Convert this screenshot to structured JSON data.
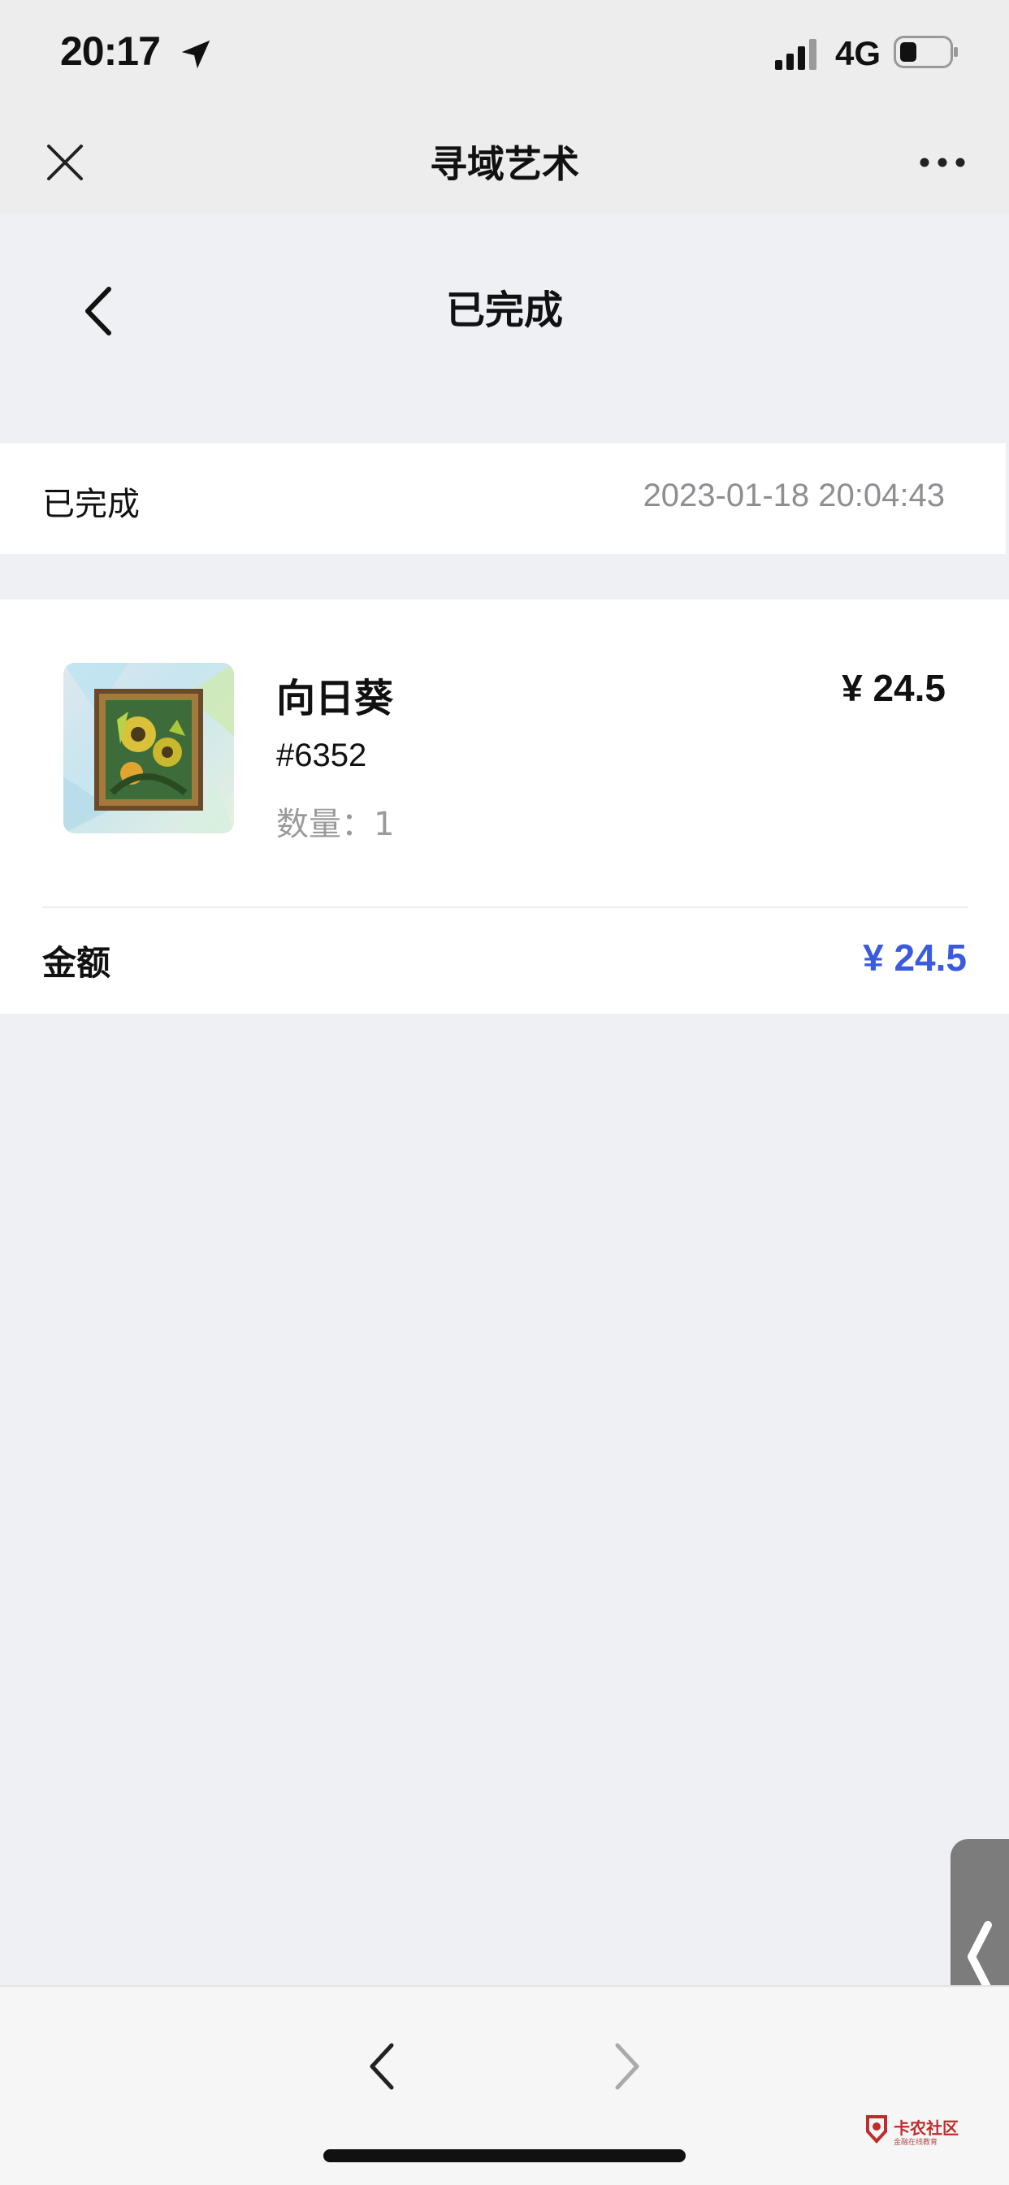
{
  "status_bar": {
    "time": "20:17",
    "network": "4G"
  },
  "nav": {
    "title": "寻域艺术"
  },
  "page": {
    "title": "已完成"
  },
  "order_status": {
    "label": "已完成",
    "datetime": "2023-01-18 20:04:43"
  },
  "item": {
    "name": "向日葵",
    "price": "¥ 24.5",
    "id": "#6352",
    "quantity": "数量：1"
  },
  "amount": {
    "label": "金额",
    "value": "¥ 24.5"
  },
  "watermark": {
    "text": "卡农社区",
    "sub": "金融在线教育"
  },
  "colors": {
    "accent": "#3a5be0",
    "page_bg": "#eef0f4",
    "muted_text": "#8e8e93"
  }
}
